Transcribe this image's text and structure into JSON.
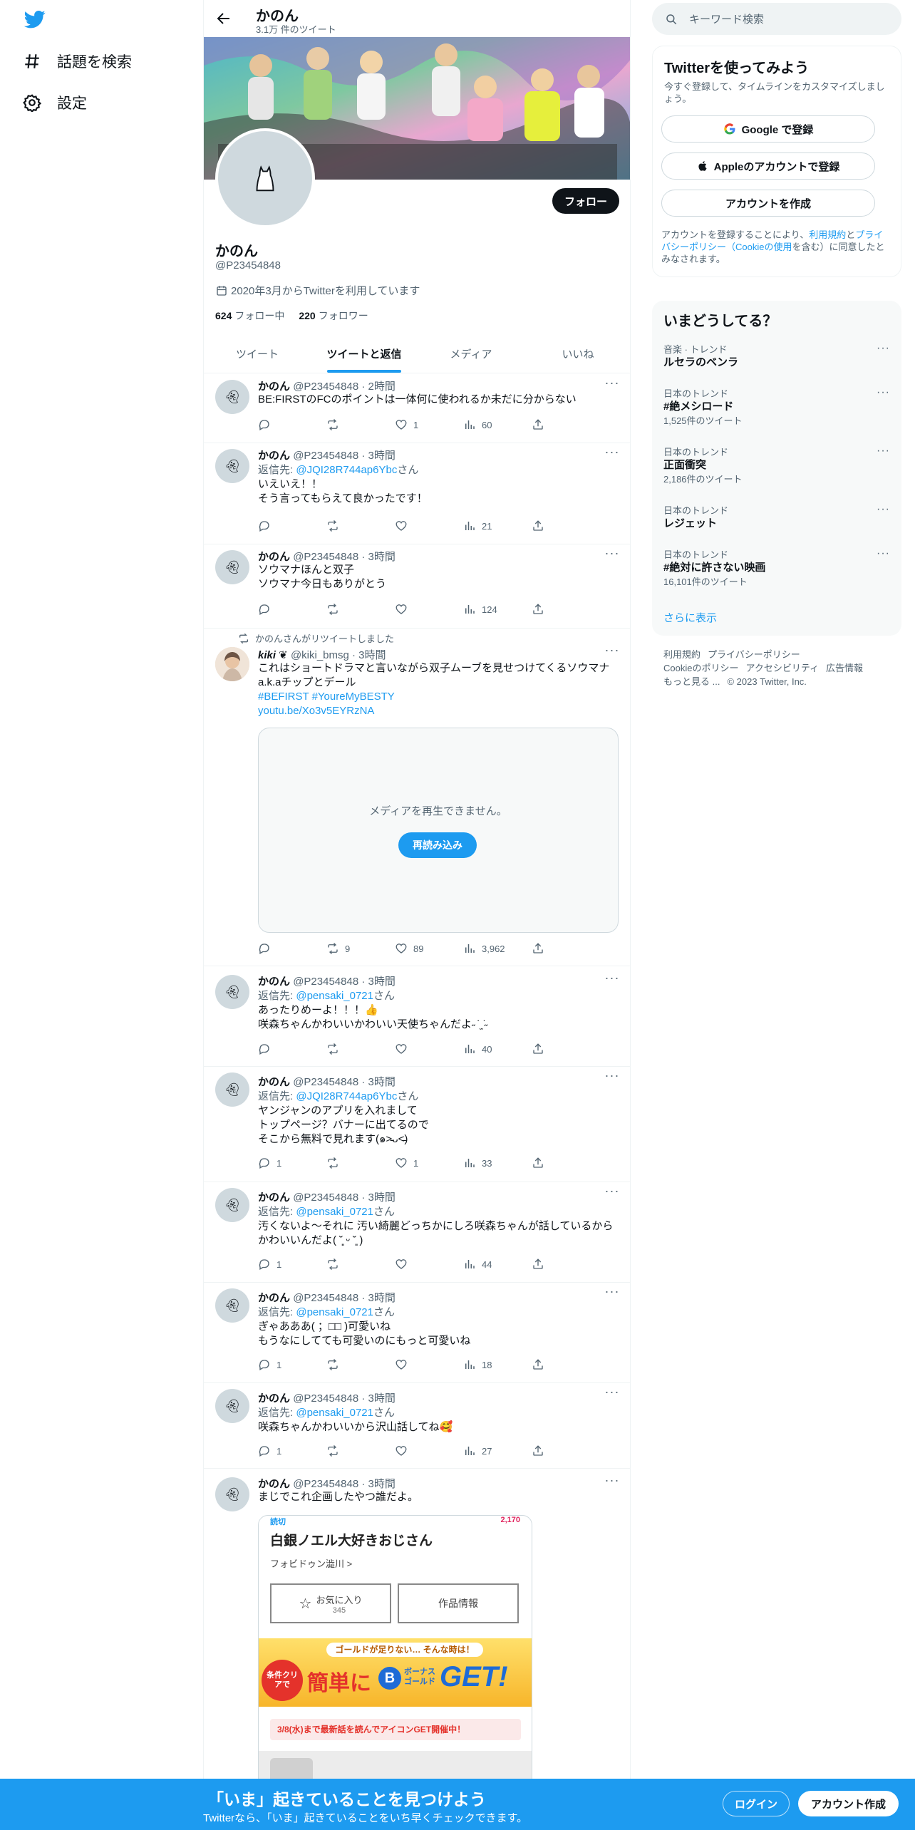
{
  "nav": {
    "explore": "話題を検索",
    "settings": "設定"
  },
  "profile": {
    "header_name": "かのん",
    "header_count": "3.1万 件のツイート",
    "name": "かのん",
    "handle": "@P23454848",
    "joined": "2020年3月からTwitterを利用しています",
    "following_count": "624",
    "following_label": "フォロー中",
    "followers_count": "220",
    "followers_label": "フォロワー",
    "follow_button": "フォロー"
  },
  "tabs": [
    "ツイート",
    "ツイートと返信",
    "メディア",
    "いいね"
  ],
  "tweets": [
    {
      "name": "かのん",
      "handle": "@P23454848 · 2時間",
      "reply_label": "",
      "reply_to": "",
      "reply_suffix": "",
      "text": "BE:FIRSTのFCのポイントは一体何に使われるか未だに分からない",
      "replies": "",
      "retweets": "",
      "likes": "1",
      "views": "60"
    },
    {
      "name": "かのん",
      "handle": "@P23454848 · 3時間",
      "reply_label": "返信先: ",
      "reply_to": "@JQI28R744ap6Ybc",
      "reply_suffix": "さん",
      "text": "いえいえ！！\nそう言ってもらえて良かったです！",
      "replies": "",
      "retweets": "",
      "likes": "",
      "views": "21"
    },
    {
      "name": "かのん",
      "handle": "@P23454848 · 3時間",
      "reply_label": "",
      "reply_to": "",
      "reply_suffix": "",
      "text": "ソウマナほんと双子\nソウマナ今日もありがとう",
      "replies": "",
      "retweets": "",
      "likes": "",
      "views": "124"
    },
    {
      "retweet_note": "かのんさんがリツイートしました",
      "name": "kiki ❦",
      "handle": "@kiki_bmsg · 3時間",
      "text": "これはショートドラマと言いながら双子ムーブを見せつけてくるソウマナa.k.aチップとデール",
      "hashtags": "#BEFIRST #YoureMyBESTY",
      "link": "youtu.be/Xo3v5EYRzNA",
      "media_message": "メディアを再生できません。",
      "reload": "再読み込み",
      "replies": "",
      "retweets": "9",
      "likes": "89",
      "views": "3,962"
    },
    {
      "name": "かのん",
      "handle": "@P23454848 · 3時間",
      "reply_label": "返信先: ",
      "reply_to": "@pensaki_0721",
      "reply_suffix": "さん",
      "text": "あったりめーよ！！！👍\n咲森ちゃんかわいいかわいい天使ちゃんだよ˶ ̇ ̫ ̇˶",
      "replies": "",
      "retweets": "",
      "likes": "",
      "views": "40"
    },
    {
      "name": "かのん",
      "handle": "@P23454848 · 3時間",
      "reply_label": "返信先: ",
      "reply_to": "@JQI28R744ap6Ybc",
      "reply_suffix": "さん",
      "text": "ヤンジャンのアプリを入れまして\nトップページ？バナーに出てるので\nそこから無料で見れます(๑˃̵ᴗ˂̵)",
      "replies": "1",
      "retweets": "",
      "likes": "1",
      "views": "33"
    },
    {
      "name": "かのん",
      "handle": "@P23454848 · 3時間",
      "reply_label": "返信先: ",
      "reply_to": "@pensaki_0721",
      "reply_suffix": "さん",
      "text": "汚くないよ〜それに 汚い綺麗どっちかにしろ咲森ちゃんが話しているから\nかわいいんだよ( ˘͈ ᵕ ˘͈ )",
      "replies": "1",
      "retweets": "",
      "likes": "",
      "views": "44"
    },
    {
      "name": "かのん",
      "handle": "@P23454848 · 3時間",
      "reply_label": "返信先: ",
      "reply_to": "@pensaki_0721",
      "reply_suffix": "さん",
      "text": "ぎゃあああ( ；□□ )可愛いね\nもうなにしてても可愛いのにもっと可愛いね",
      "replies": "1",
      "retweets": "",
      "likes": "",
      "views": "18"
    },
    {
      "name": "かのん",
      "handle": "@P23454848 · 3時間",
      "reply_label": "返信先: ",
      "reply_to": "@pensaki_0721",
      "reply_suffix": "さん",
      "text": "咲森ちゃんかわいいから沢山話してね🥰",
      "replies": "1",
      "retweets": "",
      "likes": "",
      "views": "27"
    },
    {
      "name": "かのん",
      "handle": "@P23454848 · 3時間",
      "text": "まじでこれ企画したやつ誰だよ。"
    }
  ],
  "screenshot": {
    "tag": "読切",
    "count": "2,170",
    "title": "白銀ノエル大好きおじさん",
    "author": "フォビドゥン澁川 >",
    "fav_label": "お気に入り",
    "fav_count": "345",
    "info_label": "作品情報",
    "banner_top": "ゴールドが足りない… そんな時は！",
    "banner_badge": "条件クリアで",
    "banner_main": "簡単に",
    "banner_b": "B",
    "banner_bonus": "ボーナスゴールド",
    "banner_get": "GET!",
    "notice": "3/8(水)まで最新話を読んでアイコンGET開催中！"
  },
  "right": {
    "search_placeholder": "キーワード検索",
    "signup_title": "Twitterを使ってみよう",
    "signup_sub": "今すぐ登録して、タイムラインをカスタマイズしましょう。",
    "google_btn": "Google で登録",
    "apple_btn": "Appleのアカウントで登録",
    "create_btn": "アカウントを作成",
    "legal_1": "アカウントを登録することにより、",
    "legal_terms": "利用規約",
    "legal_and": "と",
    "legal_privacy": "プライバシーポリシー（Cookieの使用",
    "legal_2": "を含む）に同意したとみなされます。",
    "trends_title": "いまどうしてる？",
    "trends": [
      {
        "category": "音楽 · トレンド",
        "name": "ルセラのベンラ",
        "count": ""
      },
      {
        "category": "日本のトレンド",
        "name": "#絶メシロード",
        "count": "1,525件のツイート"
      },
      {
        "category": "日本のトレンド",
        "name": "正面衝突",
        "count": "2,186件のツイート"
      },
      {
        "category": "日本のトレンド",
        "name": "レジェット",
        "count": ""
      },
      {
        "category": "日本のトレンド",
        "name": "#絶対に許さない映画",
        "count": "16,101件のツイート"
      }
    ],
    "show_more": "さらに表示",
    "footer": [
      "利用規約",
      "プライバシーポリシー",
      "Cookieのポリシー",
      "アクセシビリティ",
      "広告情報",
      "もっと見る ...",
      "© 2023 Twitter, Inc."
    ]
  },
  "bottom": {
    "title": "「いま」起きていることを見つけよう",
    "subtitle": "Twitterなら、「いま」起きていることをいち早くチェックできます。",
    "login": "ログイン",
    "signup": "アカウント作成"
  },
  "colors": {
    "accent": "#1d9bf0",
    "text": "#0f1419",
    "secondary": "#536471",
    "border": "#eff3f4"
  }
}
